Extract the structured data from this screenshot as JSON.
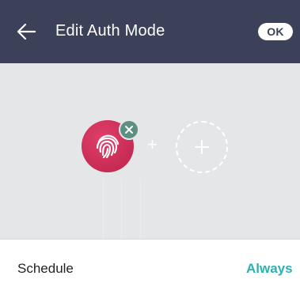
{
  "header": {
    "title": "Edit Auth Mode",
    "ok_label": "OK",
    "back_icon": "arrow-left-icon",
    "background": "#3a4158"
  },
  "auth_mode": {
    "methods": [
      {
        "icon": "fingerprint-icon",
        "color": "#cc2f58",
        "removable": true
      }
    ],
    "separator": "+",
    "add_icon": "plus-icon",
    "remove_icon": "close-icon",
    "remove_badge_color": "#5d8f83"
  },
  "schedule": {
    "label": "Schedule",
    "value": "Always",
    "value_color": "#2fb0b0"
  }
}
